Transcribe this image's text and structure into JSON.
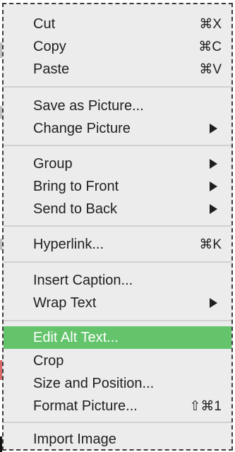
{
  "menu": {
    "items": [
      {
        "label": "Cut",
        "shortcut": "⌘X"
      },
      {
        "label": "Copy",
        "shortcut": "⌘C"
      },
      {
        "label": "Paste",
        "shortcut": "⌘V"
      },
      {
        "label": "Save as Picture..."
      },
      {
        "label": "Change Picture",
        "submenu_icon": "chevron-right-icon"
      },
      {
        "label": "Group",
        "submenu_icon": "chevron-right-icon"
      },
      {
        "label": "Bring to Front",
        "submenu_icon": "chevron-right-icon"
      },
      {
        "label": "Send to Back",
        "submenu_icon": "chevron-right-icon"
      },
      {
        "label": "Hyperlink...",
        "shortcut": "⌘K"
      },
      {
        "label": "Insert Caption..."
      },
      {
        "label": "Wrap Text",
        "submenu_icon": "chevron-right-icon"
      },
      {
        "label": "Edit Alt Text...",
        "highlighted": true
      },
      {
        "label": "Crop"
      },
      {
        "label": "Size and Position..."
      },
      {
        "label": "Format Picture...",
        "shortcut": "⇧⌘1"
      },
      {
        "label": "Import Image"
      }
    ]
  },
  "colors": {
    "menu_background": "#ececec",
    "highlight": "#63c46b",
    "separator": "#d1d1d1",
    "text": "#1f1f1f"
  }
}
